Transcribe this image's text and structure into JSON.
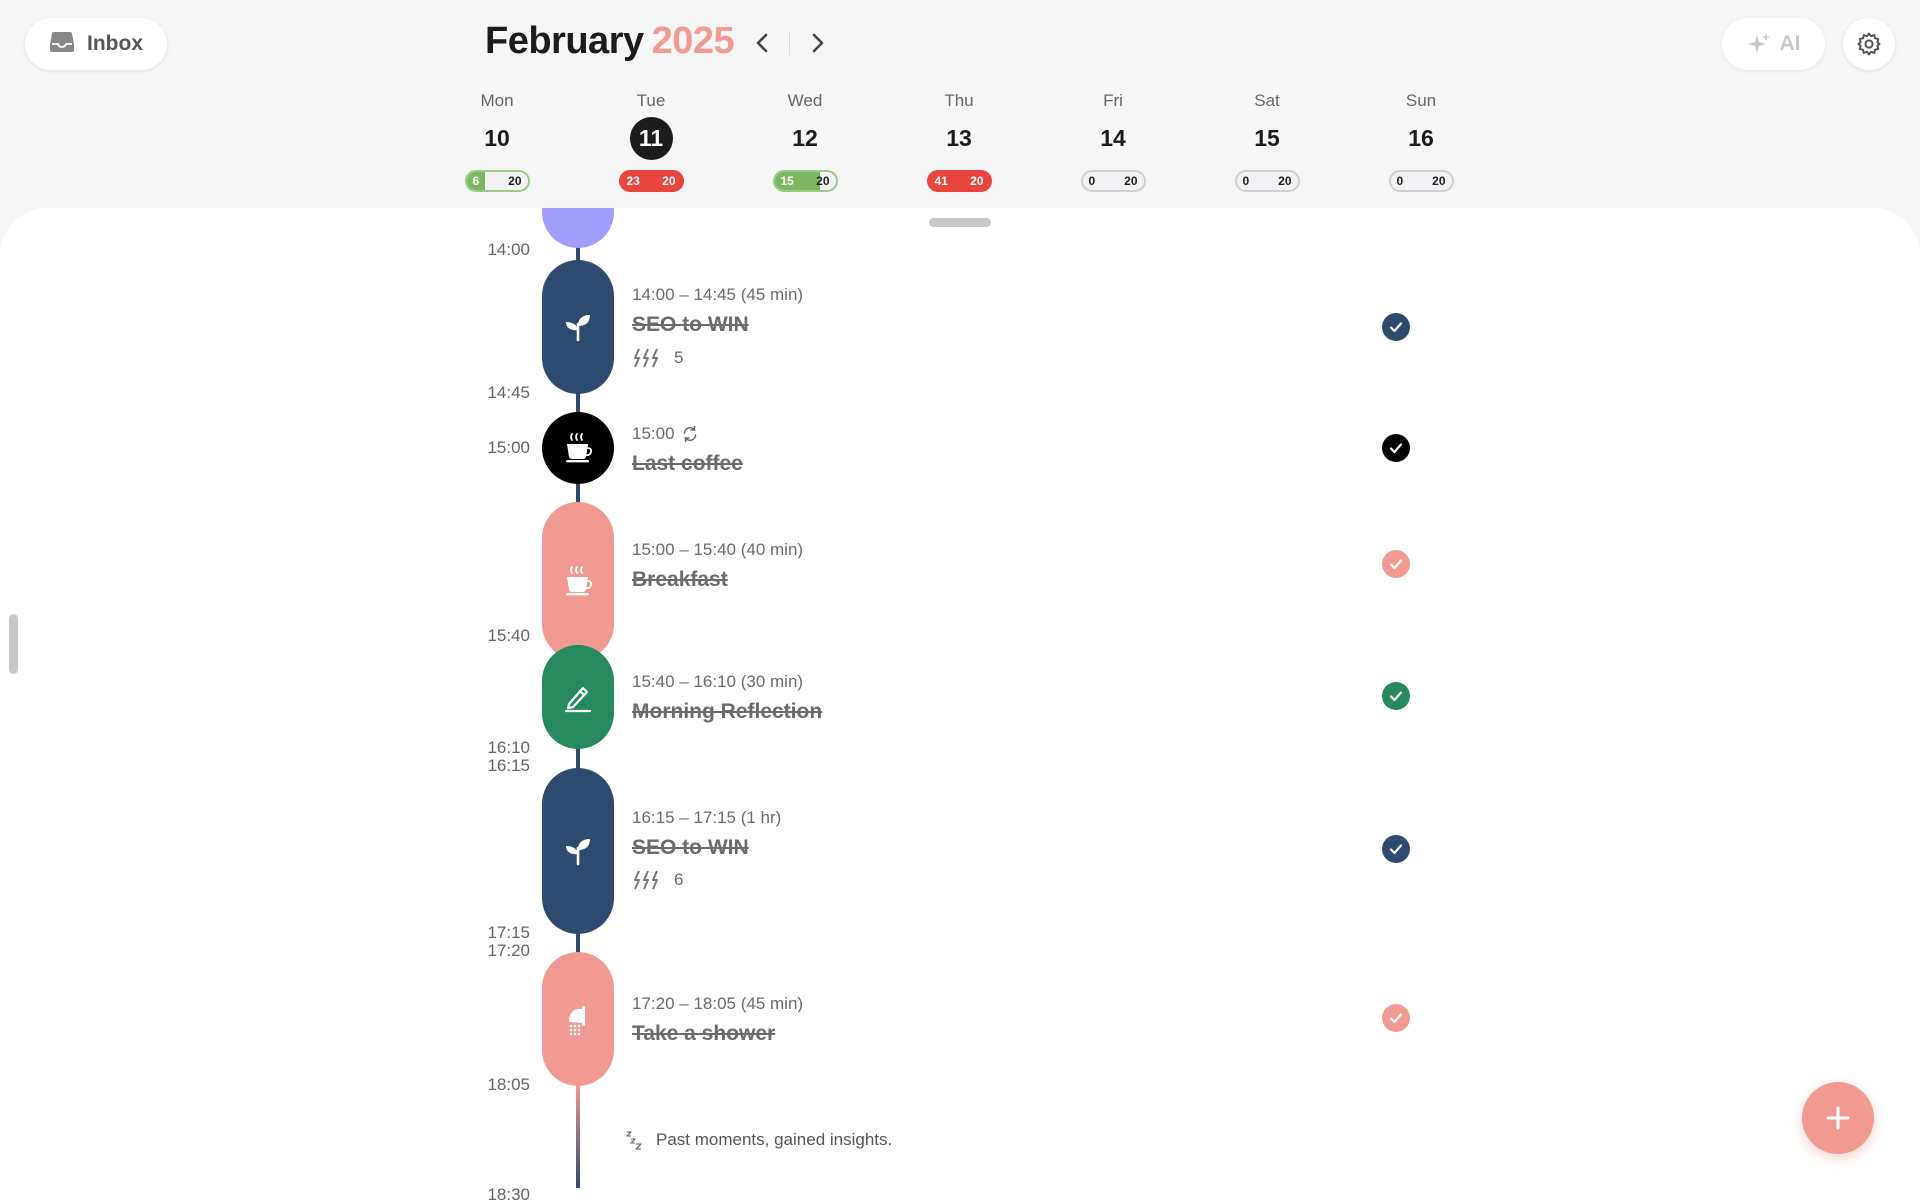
{
  "header": {
    "inbox_label": "Inbox",
    "month": "February",
    "year": "2025",
    "ai_label": "AI"
  },
  "week": [
    {
      "dow": "Mon",
      "num": "10",
      "done": "6",
      "total": "20",
      "state": "green",
      "progress": 0.3
    },
    {
      "dow": "Tue",
      "num": "11",
      "done": "23",
      "total": "20",
      "state": "red",
      "progress": 1,
      "today": true
    },
    {
      "dow": "Wed",
      "num": "12",
      "done": "15",
      "total": "20",
      "state": "green",
      "progress": 0.75
    },
    {
      "dow": "Thu",
      "num": "13",
      "done": "41",
      "total": "20",
      "state": "red",
      "progress": 1
    },
    {
      "dow": "Fri",
      "num": "14",
      "done": "0",
      "total": "20",
      "state": "empty",
      "progress": 0
    },
    {
      "dow": "Sat",
      "num": "15",
      "done": "0",
      "total": "20",
      "state": "empty",
      "progress": 0
    },
    {
      "dow": "Sun",
      "num": "16",
      "done": "0",
      "total": "20",
      "state": "empty",
      "progress": 0
    }
  ],
  "timeline": {
    "times": [
      "14:00",
      "14:45",
      "15:00",
      "15:40",
      "16:10",
      "16:15",
      "17:15",
      "17:20",
      "18:05",
      "18:30"
    ],
    "events": [
      {
        "time": "14:00 – 14:45 (45 min)",
        "title": "SEO to WIN",
        "count": "5",
        "icon": "sprout-icon",
        "color": "#2e4a6e"
      },
      {
        "time": "15:00",
        "title": "Last coffee",
        "repeat": true,
        "icon": "coffee-icon",
        "color": "#000000"
      },
      {
        "time": "15:00 – 15:40 (40 min)",
        "title": "Breakfast",
        "icon": "coffee-icon",
        "color": "#f19a93"
      },
      {
        "time": "15:40 – 16:10 (30 min)",
        "title": "Morning Reflection",
        "icon": "pencil-icon",
        "color": "#268a5e"
      },
      {
        "time": "16:15 – 17:15 (1 hr)",
        "title": "SEO to WIN",
        "count": "6",
        "icon": "sprout-icon",
        "color": "#2e4a6e"
      },
      {
        "time": "17:20 – 18:05 (45 min)",
        "title": "Take a shower",
        "icon": "shower-icon",
        "color": "#f19a93"
      }
    ],
    "footer_note": "Past moments, gained insights."
  },
  "colors": {
    "accent": "#f19a93",
    "navy": "#2e4a6e",
    "green": "#268a5e",
    "lavender": "#a19dfa"
  }
}
